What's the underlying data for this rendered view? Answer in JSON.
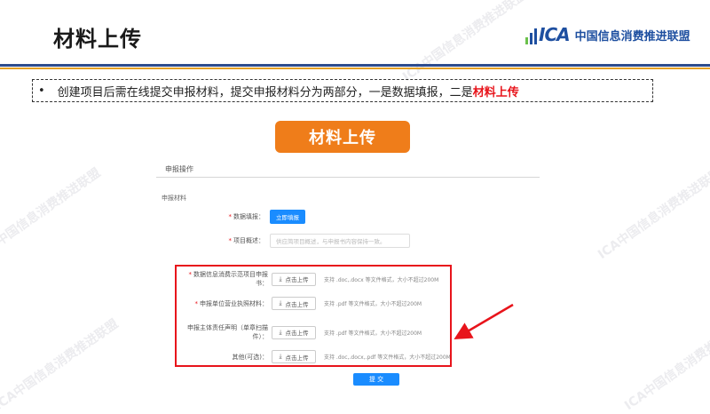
{
  "slide": {
    "title": "材料上传",
    "logo_mark": "ICA",
    "logo_name": "中国信息消费推进联盟"
  },
  "intro": {
    "bullet": "•",
    "text": "创建项目后需在线提交申报材料，提交申报材料分为两部分，一是数据填报，二是",
    "highlight": "材料上传"
  },
  "banner": {
    "label": "材料上传"
  },
  "form": {
    "section_title": "申报操作",
    "sub_title": "申报材料",
    "data_fill": {
      "label": "数据填报：",
      "button": "立即填报"
    },
    "project_summary": {
      "label": "项目概述：",
      "placeholder": "供应简项目概述，与申报书内容保持一致。"
    },
    "uploads": [
      {
        "label": "数据信息消费示范项目申报书：",
        "required": true,
        "button": "点击上传",
        "hint": "支持 .doc,.docx 等文件格式，大小不超过200M"
      },
      {
        "label": "申报单位营业执照材料：",
        "required": true,
        "button": "点击上传",
        "hint": "支持 .pdf 等文件格式，大小不超过200M"
      },
      {
        "label": "申报主体责任声明（单章扫描件）：",
        "required": false,
        "button": "点击上传",
        "hint": "支持 .pdf 等文件格式，大小不超过200M"
      },
      {
        "label": "其他(可选)：",
        "required": false,
        "button": "点击上传",
        "hint": "支持 .doc,.docx,.pdf 等文件格式，大小不超过200M"
      }
    ],
    "submit": "提 交"
  },
  "watermark_text": "ICA中国信息消费推进联盟",
  "colors": {
    "brand_blue": "#1e4fa0",
    "accent_orange": "#ef7d1a",
    "highlight_red": "#e8141b",
    "button_blue": "#1a8cff",
    "header_gold": "#e4a024"
  }
}
